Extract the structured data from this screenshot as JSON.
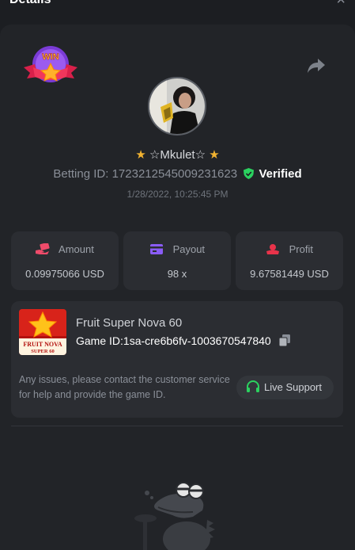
{
  "header": {
    "title": "Details",
    "close_label": "×"
  },
  "badge": {
    "text": "WIN"
  },
  "user": {
    "star_left": "★",
    "name": "☆Mkulet☆",
    "star_right": "★",
    "betting_id_label": "Betting ID:",
    "betting_id": "17232125450092316​23",
    "verified_label": "Verified",
    "timestamp": "1/28/2022, 10:25:45 PM"
  },
  "stats": [
    {
      "label": "Amount",
      "value": "0.09975066 USD",
      "icon": "money-hand-icon",
      "color": "#ef4b6a"
    },
    {
      "label": "Payout",
      "value": "98 x",
      "icon": "card-icon",
      "color": "#8a5cf6"
    },
    {
      "label": "Profit",
      "value": "9.67581449 USD",
      "icon": "profit-icon",
      "color": "#e8334a"
    }
  ],
  "game": {
    "thumb_title": "FRUIT NOVA",
    "thumb_sub": "SUPER 60",
    "name": "Fruit Super Nova 60",
    "id_label": "Game ID:",
    "id": "1sa-cre6b6fv-1003670547840",
    "support_text": "Any issues, please contact the customer service for help and provide the game ID.",
    "live_support_label": "Live Support"
  },
  "colors": {
    "accent_green": "#2bd15f",
    "star": "#f2b331",
    "background": "#1c1e22",
    "card": "#2b2d32"
  }
}
